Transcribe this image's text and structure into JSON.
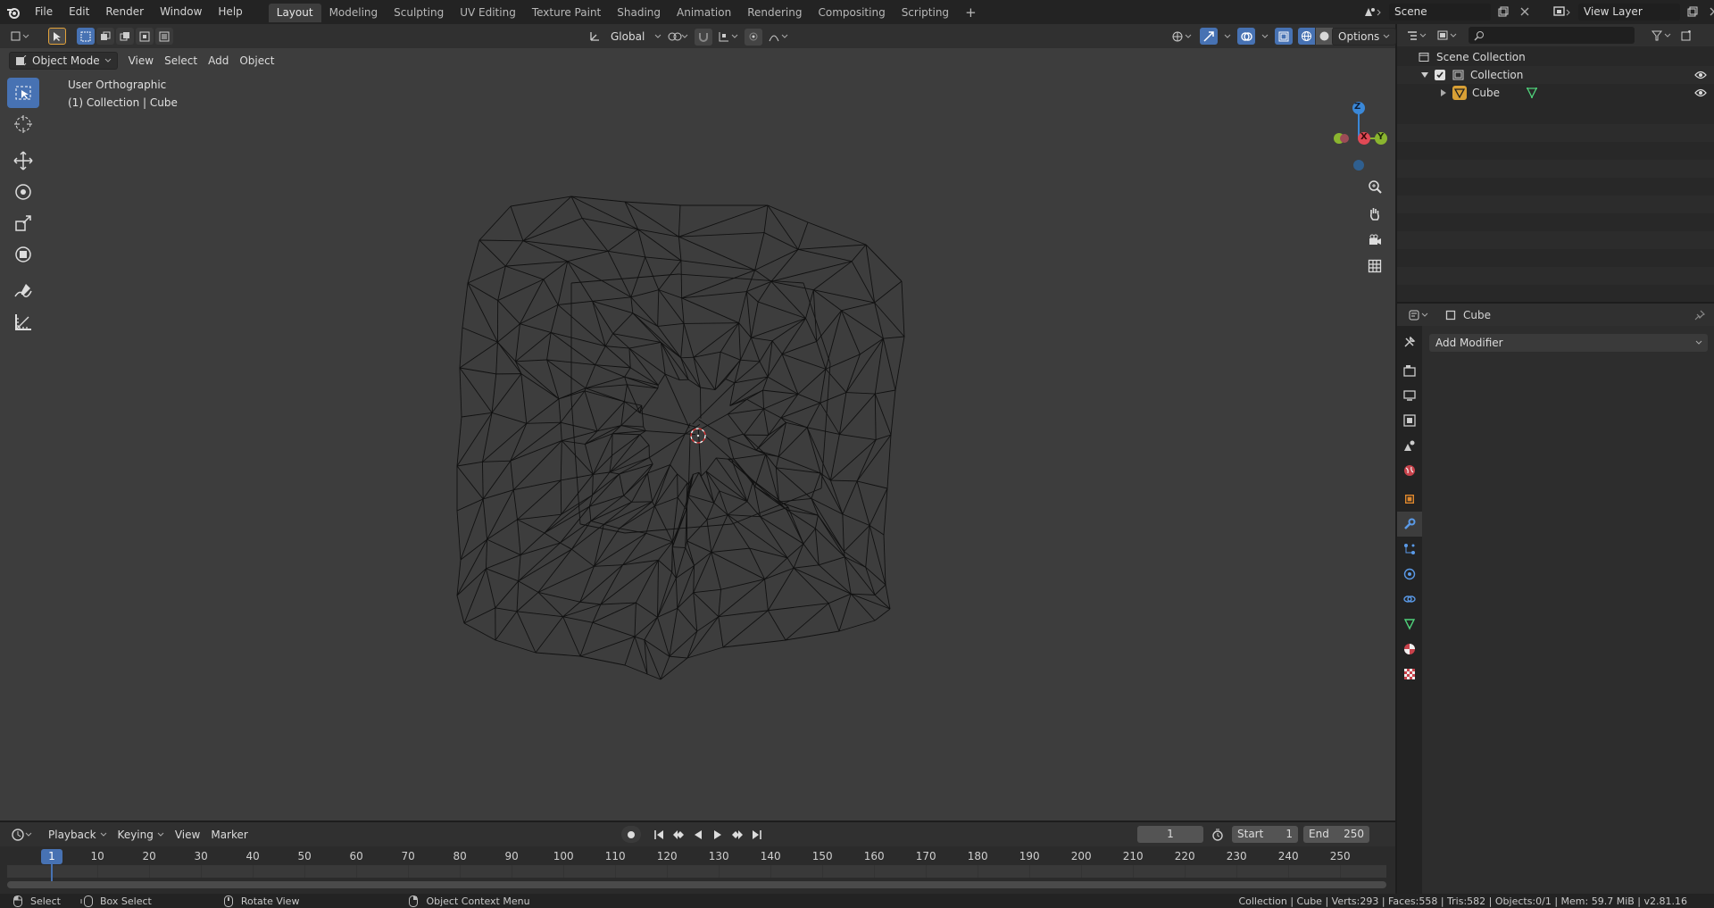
{
  "topbar": {
    "menu": [
      "File",
      "Edit",
      "Render",
      "Window",
      "Help"
    ],
    "tabs": [
      "Layout",
      "Modeling",
      "Sculpting",
      "UV Editing",
      "Texture Paint",
      "Shading",
      "Animation",
      "Rendering",
      "Compositing",
      "Scripting"
    ],
    "active_tab": "Layout",
    "add_tab": "+",
    "scene": "Scene",
    "view_layer": "View Layer"
  },
  "viewport": {
    "mode": "Object Mode",
    "menus": [
      "View",
      "Select",
      "Add",
      "Object"
    ],
    "orientation": "Global",
    "options": "Options",
    "view_name": "User Orthographic",
    "context": "(1) Collection | Cube",
    "gizmo": {
      "z": "Z",
      "x": "X",
      "y": "Y"
    },
    "wire_color": "#111111",
    "bg_color": "#3d3d3d"
  },
  "toolbar": {
    "tools": [
      "select-box",
      "cursor",
      "move",
      "rotate",
      "scale",
      "transform",
      "annotate",
      "measure"
    ]
  },
  "timeline": {
    "menus": [
      "Playback",
      "Keying",
      "View",
      "Marker"
    ],
    "current_frame": "1",
    "start_label": "Start",
    "start": "1",
    "end_label": "End",
    "end": "250",
    "ruler": [
      "1",
      "10",
      "20",
      "30",
      "40",
      "50",
      "60",
      "70",
      "80",
      "90",
      "100",
      "110",
      "120",
      "130",
      "140",
      "150",
      "160",
      "170",
      "180",
      "190",
      "200",
      "210",
      "220",
      "230",
      "240",
      "250"
    ]
  },
  "statusbar": {
    "select": "Select",
    "box_select": "Box Select",
    "rotate_view": "Rotate View",
    "context_menu": "Object Context Menu",
    "stats": "Collection | Cube | Verts:293 | Faces:558 | Tris:582 | Objects:0/1 | Mem: 59.7 MiB | v2.81.16"
  },
  "outliner": {
    "scene_collection": "Scene Collection",
    "collection": "Collection",
    "object": "Cube"
  },
  "properties": {
    "object": "Cube",
    "add_modifier": "Add Modifier",
    "accent": "#4772b3"
  }
}
